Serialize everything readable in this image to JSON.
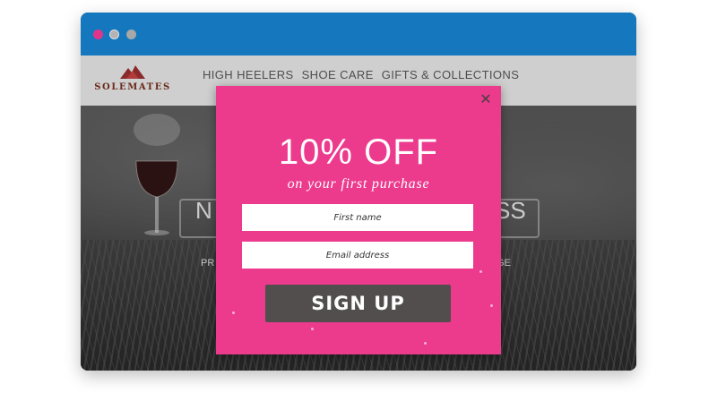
{
  "window": {
    "colors": {
      "titlebar": "#1578be",
      "close_dot": "#e1358a",
      "dots": "#b3b3b3"
    }
  },
  "site": {
    "logo_text": "SOLEMATES",
    "logo_icon": "mountain-icon",
    "nav": [
      "HIGH HEELERS",
      "SHOE CARE",
      "GIFTS & COLLECTIONS"
    ],
    "hero": {
      "heading_left": "N",
      "heading_right": "SS",
      "subtext_left": "PR",
      "subtext_right": "GE"
    }
  },
  "popup": {
    "accent": "#ec3a8d",
    "close_icon": "close-icon",
    "title": "10% OFF",
    "subtitle": "on your first purchase",
    "fields": {
      "first_name_placeholder": "First name",
      "email_placeholder": "Email address"
    },
    "button_label": "SIGN UP",
    "button_color": "#524e4e"
  }
}
